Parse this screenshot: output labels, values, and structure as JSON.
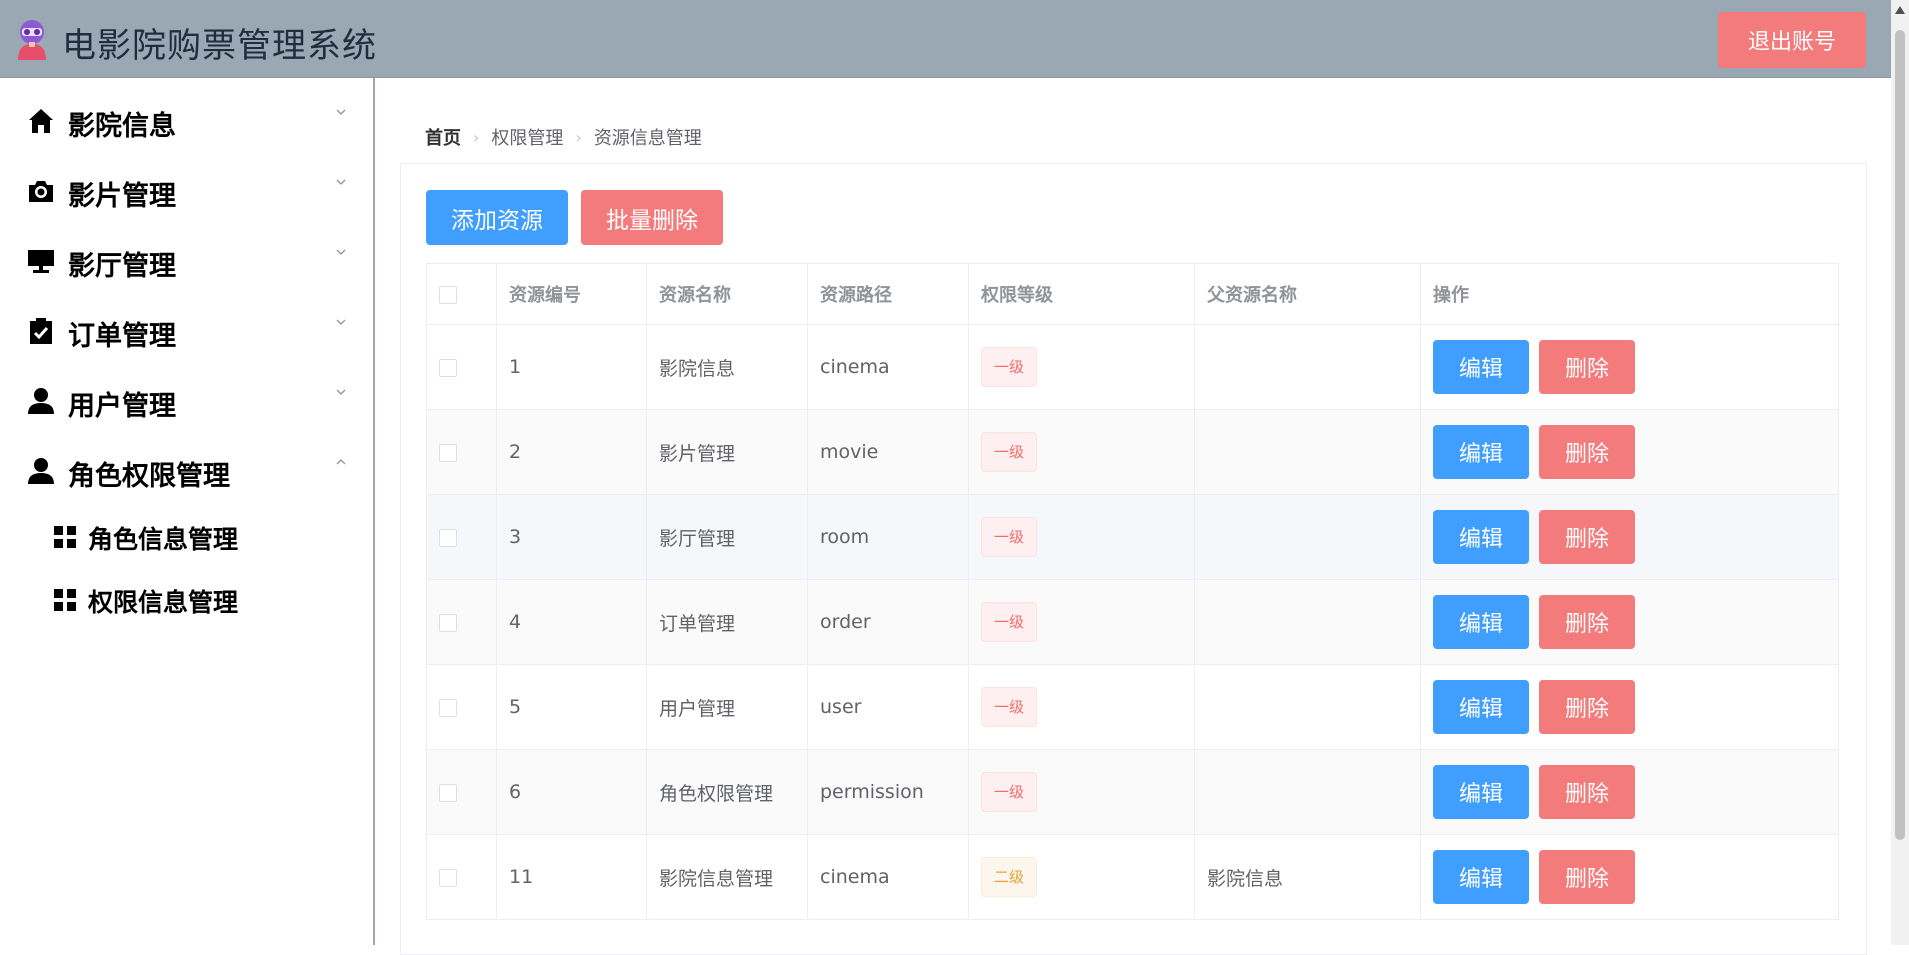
{
  "header": {
    "title": "电影院购票管理系统",
    "logout_label": "退出账号",
    "logo_icon": "cinema-avatar-icon"
  },
  "sidebar": {
    "items": [
      {
        "label": "影院信息",
        "icon": "home-icon",
        "expanded": false
      },
      {
        "label": "影片管理",
        "icon": "camera-icon",
        "expanded": false
      },
      {
        "label": "影厅管理",
        "icon": "monitor-icon",
        "expanded": false
      },
      {
        "label": "订单管理",
        "icon": "clipboard-check-icon",
        "expanded": false
      },
      {
        "label": "用户管理",
        "icon": "user-icon",
        "expanded": false
      },
      {
        "label": "角色权限管理",
        "icon": "user-icon",
        "expanded": true
      }
    ],
    "subitems": [
      {
        "label": "角色信息管理",
        "icon": "grid-icon"
      },
      {
        "label": "权限信息管理",
        "icon": "grid-icon"
      }
    ]
  },
  "breadcrumb": [
    "首页",
    "权限管理",
    "资源信息管理"
  ],
  "toolbar": {
    "add_label": "添加资源",
    "batch_delete_label": "批量删除"
  },
  "table": {
    "columns": [
      "资源编号",
      "资源名称",
      "资源路径",
      "权限等级",
      "父资源名称",
      "操作"
    ],
    "edit_label": "编辑",
    "delete_label": "删除",
    "rows": [
      {
        "id": "1",
        "name": "影院信息",
        "path": "cinema",
        "level": "一级",
        "parent": ""
      },
      {
        "id": "2",
        "name": "影片管理",
        "path": "movie",
        "level": "一级",
        "parent": ""
      },
      {
        "id": "3",
        "name": "影厅管理",
        "path": "room",
        "level": "一级",
        "parent": ""
      },
      {
        "id": "4",
        "name": "订单管理",
        "path": "order",
        "level": "一级",
        "parent": ""
      },
      {
        "id": "5",
        "name": "用户管理",
        "path": "user",
        "level": "一级",
        "parent": ""
      },
      {
        "id": "6",
        "name": "角色权限管理",
        "path": "permission",
        "level": "一级",
        "parent": ""
      },
      {
        "id": "11",
        "name": "影院信息管理",
        "path": "cinema",
        "level": "二级",
        "parent": "影院信息"
      }
    ]
  },
  "colors": {
    "header_bg": "#9aa8b4",
    "primary": "#409eff",
    "danger": "#f47b7b"
  }
}
